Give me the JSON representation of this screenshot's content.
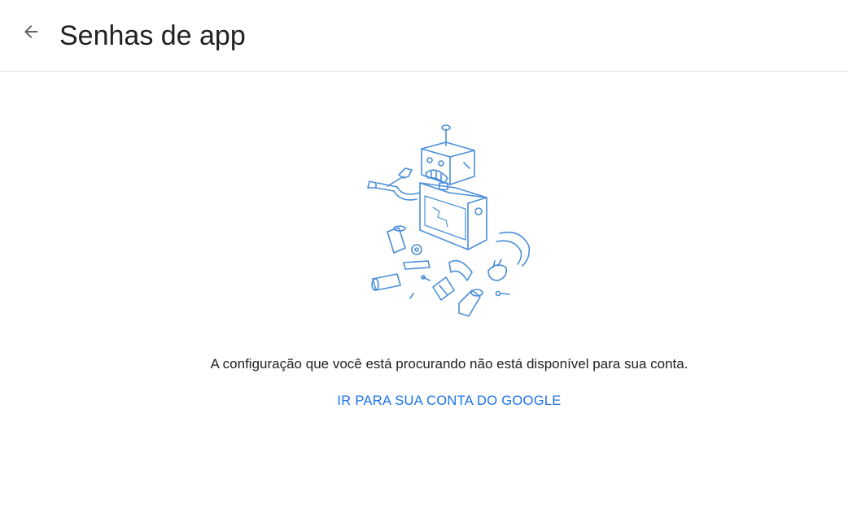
{
  "header": {
    "title": "Senhas de app",
    "back_icon": "arrow-back-icon"
  },
  "main": {
    "illustration": "broken-robot-illustration",
    "message": "A configuração que você está procurando não está disponível para sua conta.",
    "link_label": "IR PARA SUA CONTA DO GOOGLE"
  },
  "colors": {
    "link": "#1a73e8",
    "sketch": "#4a8fd8",
    "divider": "#dadce0",
    "text": "#202124"
  }
}
